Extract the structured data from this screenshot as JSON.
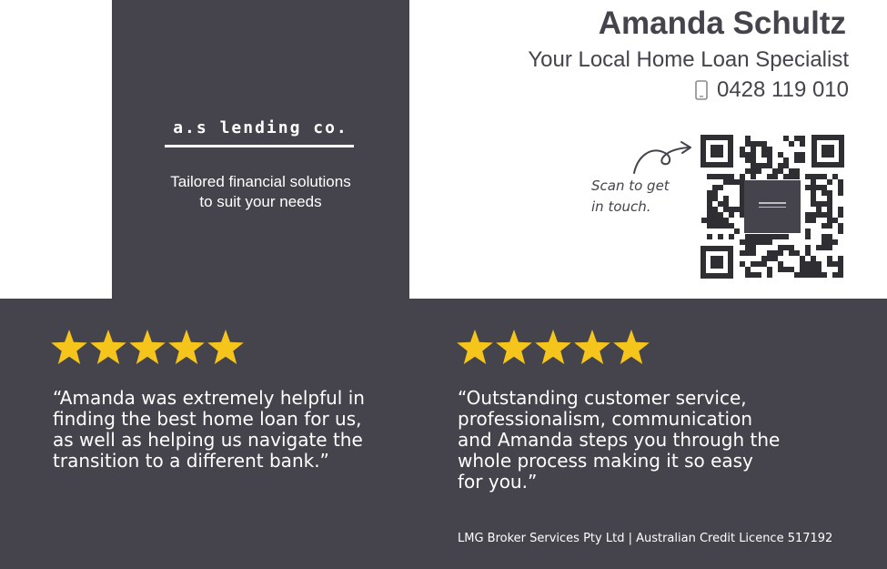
{
  "brand": {
    "logo_text": "a.s lending co.",
    "tagline": "Tailored financial solutions\nto suit your needs"
  },
  "contact": {
    "name": "Amanda Schultz",
    "title": "Your Local Home Loan Specialist",
    "phone": "0428 119 010",
    "phone_icon": "mobile-phone-icon",
    "scan_text": "Scan to get in touch."
  },
  "reviews": [
    {
      "rating": 5,
      "text": "“Amanda was extremely helpful in\nfinding the best home loan for us,\nas well as helping us navigate the\ntransition to a different bank.”"
    },
    {
      "rating": 5,
      "text": "“Outstanding customer service,\nprofessionalism, communication\nand Amanda steps you through the\nwhole process making it so easy\nfor you.”"
    }
  ],
  "footer": {
    "licence": "LMG Broker Services Pty Ltd | Australian Credit Licence 517192"
  },
  "colors": {
    "panel": "#45434b",
    "star": "#f6c51b",
    "text_dark": "#45434b",
    "text_light": "#ffffff"
  }
}
